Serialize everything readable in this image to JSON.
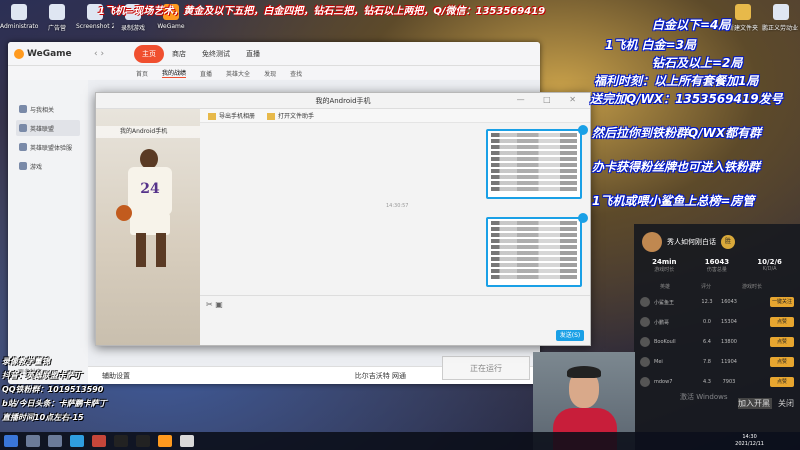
{
  "desktop_icons": [
    "Administrator",
    "广告营",
    "Screenshot 20211106",
    "录制游戏",
    "WeGame"
  ],
  "desktop_icons_right": [
    "新建文件夹",
    "鹏正义劳动业 游戏服务",
    "英雄联盟"
  ],
  "overlay": {
    "top_line": "1飞机=现场艺术，黄金及以下五把，白金四把，钻石三把，钻石以上两把，Q/微信：1353569419",
    "right_lines": [
      "白金以下=4局",
      "1飞机    白金=3局",
      "钻石及以上=2局",
      "福利时刻：以上所有套餐加1局",
      "送完加Q/WX：1353569419发号",
      "然后拉你到铁粉群Q/WX都有群",
      "办卡获得粉丝牌也可进入铁粉群",
      "1飞机或喂小鲨鱼上总榜=房管"
    ],
    "bottom_left": [
      "录像教学董锦",
      "抖音：英雄联盟卡萨丁",
      "QQ铁粉群：1019513590",
      "b站/今日头条：卡萨鹏卡萨丁",
      "直播时间10点左右-15"
    ]
  },
  "wegame": {
    "logo": "WeGame",
    "tabs": [
      "主页",
      "商店",
      "免终测试",
      "直播"
    ],
    "subtabs": [
      "首页",
      "我的战绩",
      "直播",
      "英雄大全",
      "发现",
      "查找"
    ],
    "side_items": [
      "与我相关",
      "英雄联盟",
      "英雄联盟体验服",
      "游戏"
    ],
    "side_footer": "更多社交",
    "bottom_left": "辅助设置",
    "bottom_center": "比尔吉沃特 网通",
    "run_button": "正在运行"
  },
  "android": {
    "title": "我的Android手机",
    "left_label": "我的Android手机",
    "player_number": "24",
    "toolbar": [
      "导出手机相册",
      "打开文件助手"
    ],
    "timestamp": "14:30:57",
    "send_button": "发送(S)"
  },
  "panel": {
    "name": "秀人如何刚白话",
    "badge": "胜",
    "stats": [
      {
        "value": "24min",
        "label": "游戏时长"
      },
      {
        "value": "16043",
        "label": "伤害总量"
      },
      {
        "value": "10/2/6",
        "label": "K/D/A"
      }
    ],
    "headers": [
      "英雄",
      "评分",
      "游戏时长"
    ],
    "players": [
      {
        "name": "小鲨鱼王",
        "score": "12.3",
        "dmg": "16043",
        "btn": "一键关注"
      },
      {
        "name": "小鹏哥",
        "score": "0.0",
        "dmg": "15304",
        "btn": "点赞"
      },
      {
        "name": "BooKoull",
        "score": "6.4",
        "dmg": "13800",
        "btn": "点赞"
      },
      {
        "name": "Mei",
        "score": "7.8",
        "dmg": "11904",
        "btn": "点赞"
      },
      {
        "name": "mdow7",
        "score": "4.3",
        "dmg": "7903",
        "btn": "点赞"
      }
    ],
    "footer_btns": [
      "加入开黑",
      "关闭"
    ]
  },
  "windows_watermark": "激活 Windows",
  "clock": {
    "time": "14:30",
    "date": "2021/12/11"
  }
}
